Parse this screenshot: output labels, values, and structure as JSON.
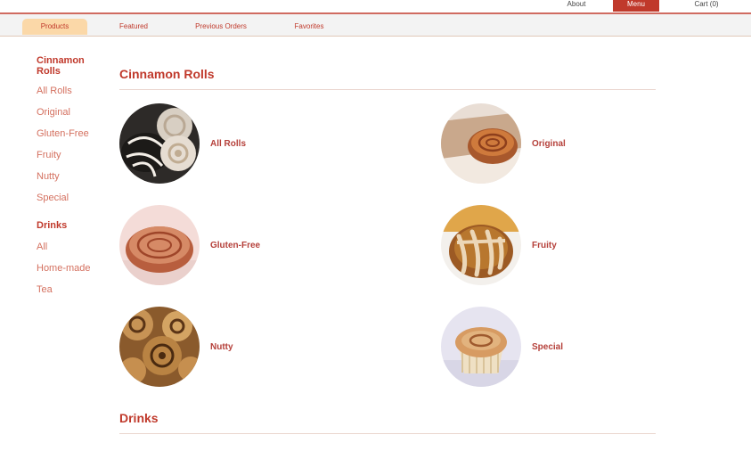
{
  "topbar": {
    "about": "About",
    "menu": "Menu",
    "cart": "Cart (0)"
  },
  "tabs": [
    "Products",
    "Featured",
    "Previous Orders",
    "Favorites"
  ],
  "sidebar": {
    "rolls_heading": "Cinnamon Rolls",
    "rolls_items": [
      "All Rolls",
      "Original",
      "Gluten-Free",
      "Fruity",
      "Nutty",
      "Special"
    ],
    "drinks_heading": "Drinks",
    "drinks_items": [
      "All",
      "Home-made",
      "Tea"
    ]
  },
  "sections": {
    "rolls_title": "Cinnamon Rolls",
    "drinks_title": "Drinks"
  },
  "products": [
    {
      "label": "All Rolls",
      "icon": "cinnamon-rolls-photo"
    },
    {
      "label": "Original",
      "icon": "cinnamon-roll-photo"
    },
    {
      "label": "Gluten-Free",
      "icon": "cinnamon-roll-photo"
    },
    {
      "label": "Fruity",
      "icon": "cinnamon-roll-photo"
    },
    {
      "label": "Nutty",
      "icon": "cinnamon-rolls-photo"
    },
    {
      "label": "Special",
      "icon": "cinnamon-roll-photo"
    }
  ],
  "colors": {
    "accent": "#c0392b",
    "active_tab": "#fbd8a8",
    "link": "#d4705f"
  }
}
